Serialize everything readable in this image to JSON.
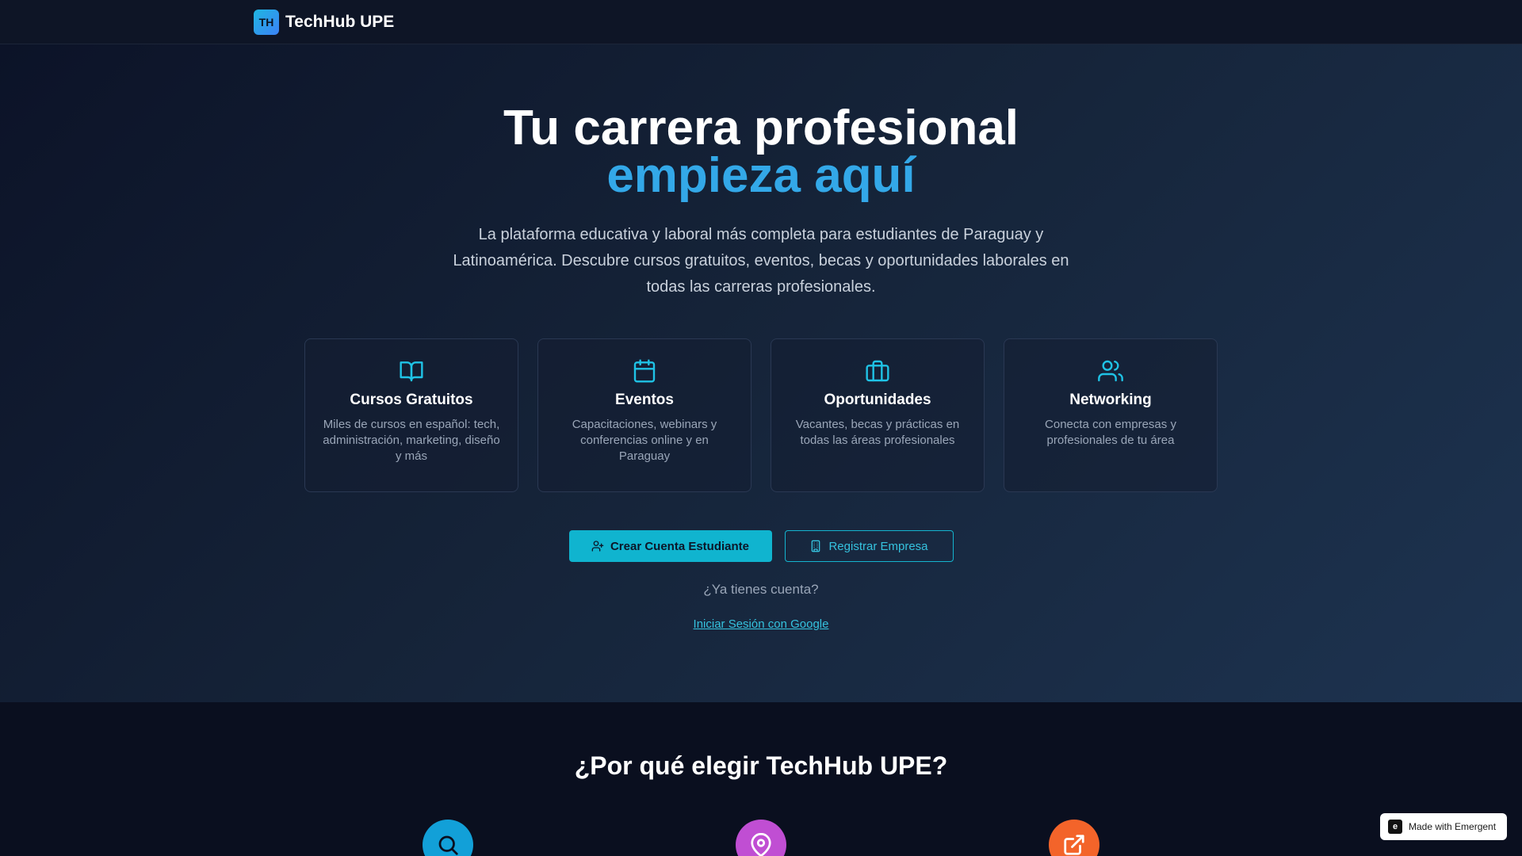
{
  "nav": {
    "logo_text": "TH",
    "brand": "TechHub UPE"
  },
  "hero": {
    "title_line1": "Tu carrera profesional",
    "title_line2": "empieza aquí",
    "subtitle": "La plataforma educativa y laboral más completa para estudiantes de Paraguay y Latinoamérica. Descubre cursos gratuitos, eventos, becas y oportunidades laborales en todas las carreras profesionales."
  },
  "features": [
    {
      "icon": "book-open-icon",
      "title": "Cursos Gratuitos",
      "desc": "Miles de cursos en español: tech, administración, marketing, diseño y más"
    },
    {
      "icon": "calendar-icon",
      "title": "Eventos",
      "desc": "Capacitaciones, webinars y conferencias online y en Paraguay"
    },
    {
      "icon": "briefcase-icon",
      "title": "Oportunidades",
      "desc": "Vacantes, becas y prácticas en todas las áreas profesionales"
    },
    {
      "icon": "users-icon",
      "title": "Networking",
      "desc": "Conecta con empresas y profesionales de tu área"
    }
  ],
  "buttons": {
    "student": "Crear Cuenta Estudiante",
    "company": "Registrar Empresa"
  },
  "login": {
    "question": "¿Ya tienes cuenta?",
    "google": "Iniciar Sesión con Google"
  },
  "why": {
    "title": "¿Por qué elegir TechHub UPE?",
    "icons": [
      "search-icon",
      "map-pin-icon",
      "external-link-icon"
    ]
  },
  "badge": {
    "text": "Made with Emergent"
  },
  "colors": {
    "accent": "#33a8e8",
    "cyan": "#10b4cf",
    "circle_blue": "#12a0d8",
    "circle_purple": "#c04ed3",
    "circle_orange": "#f3642a"
  }
}
